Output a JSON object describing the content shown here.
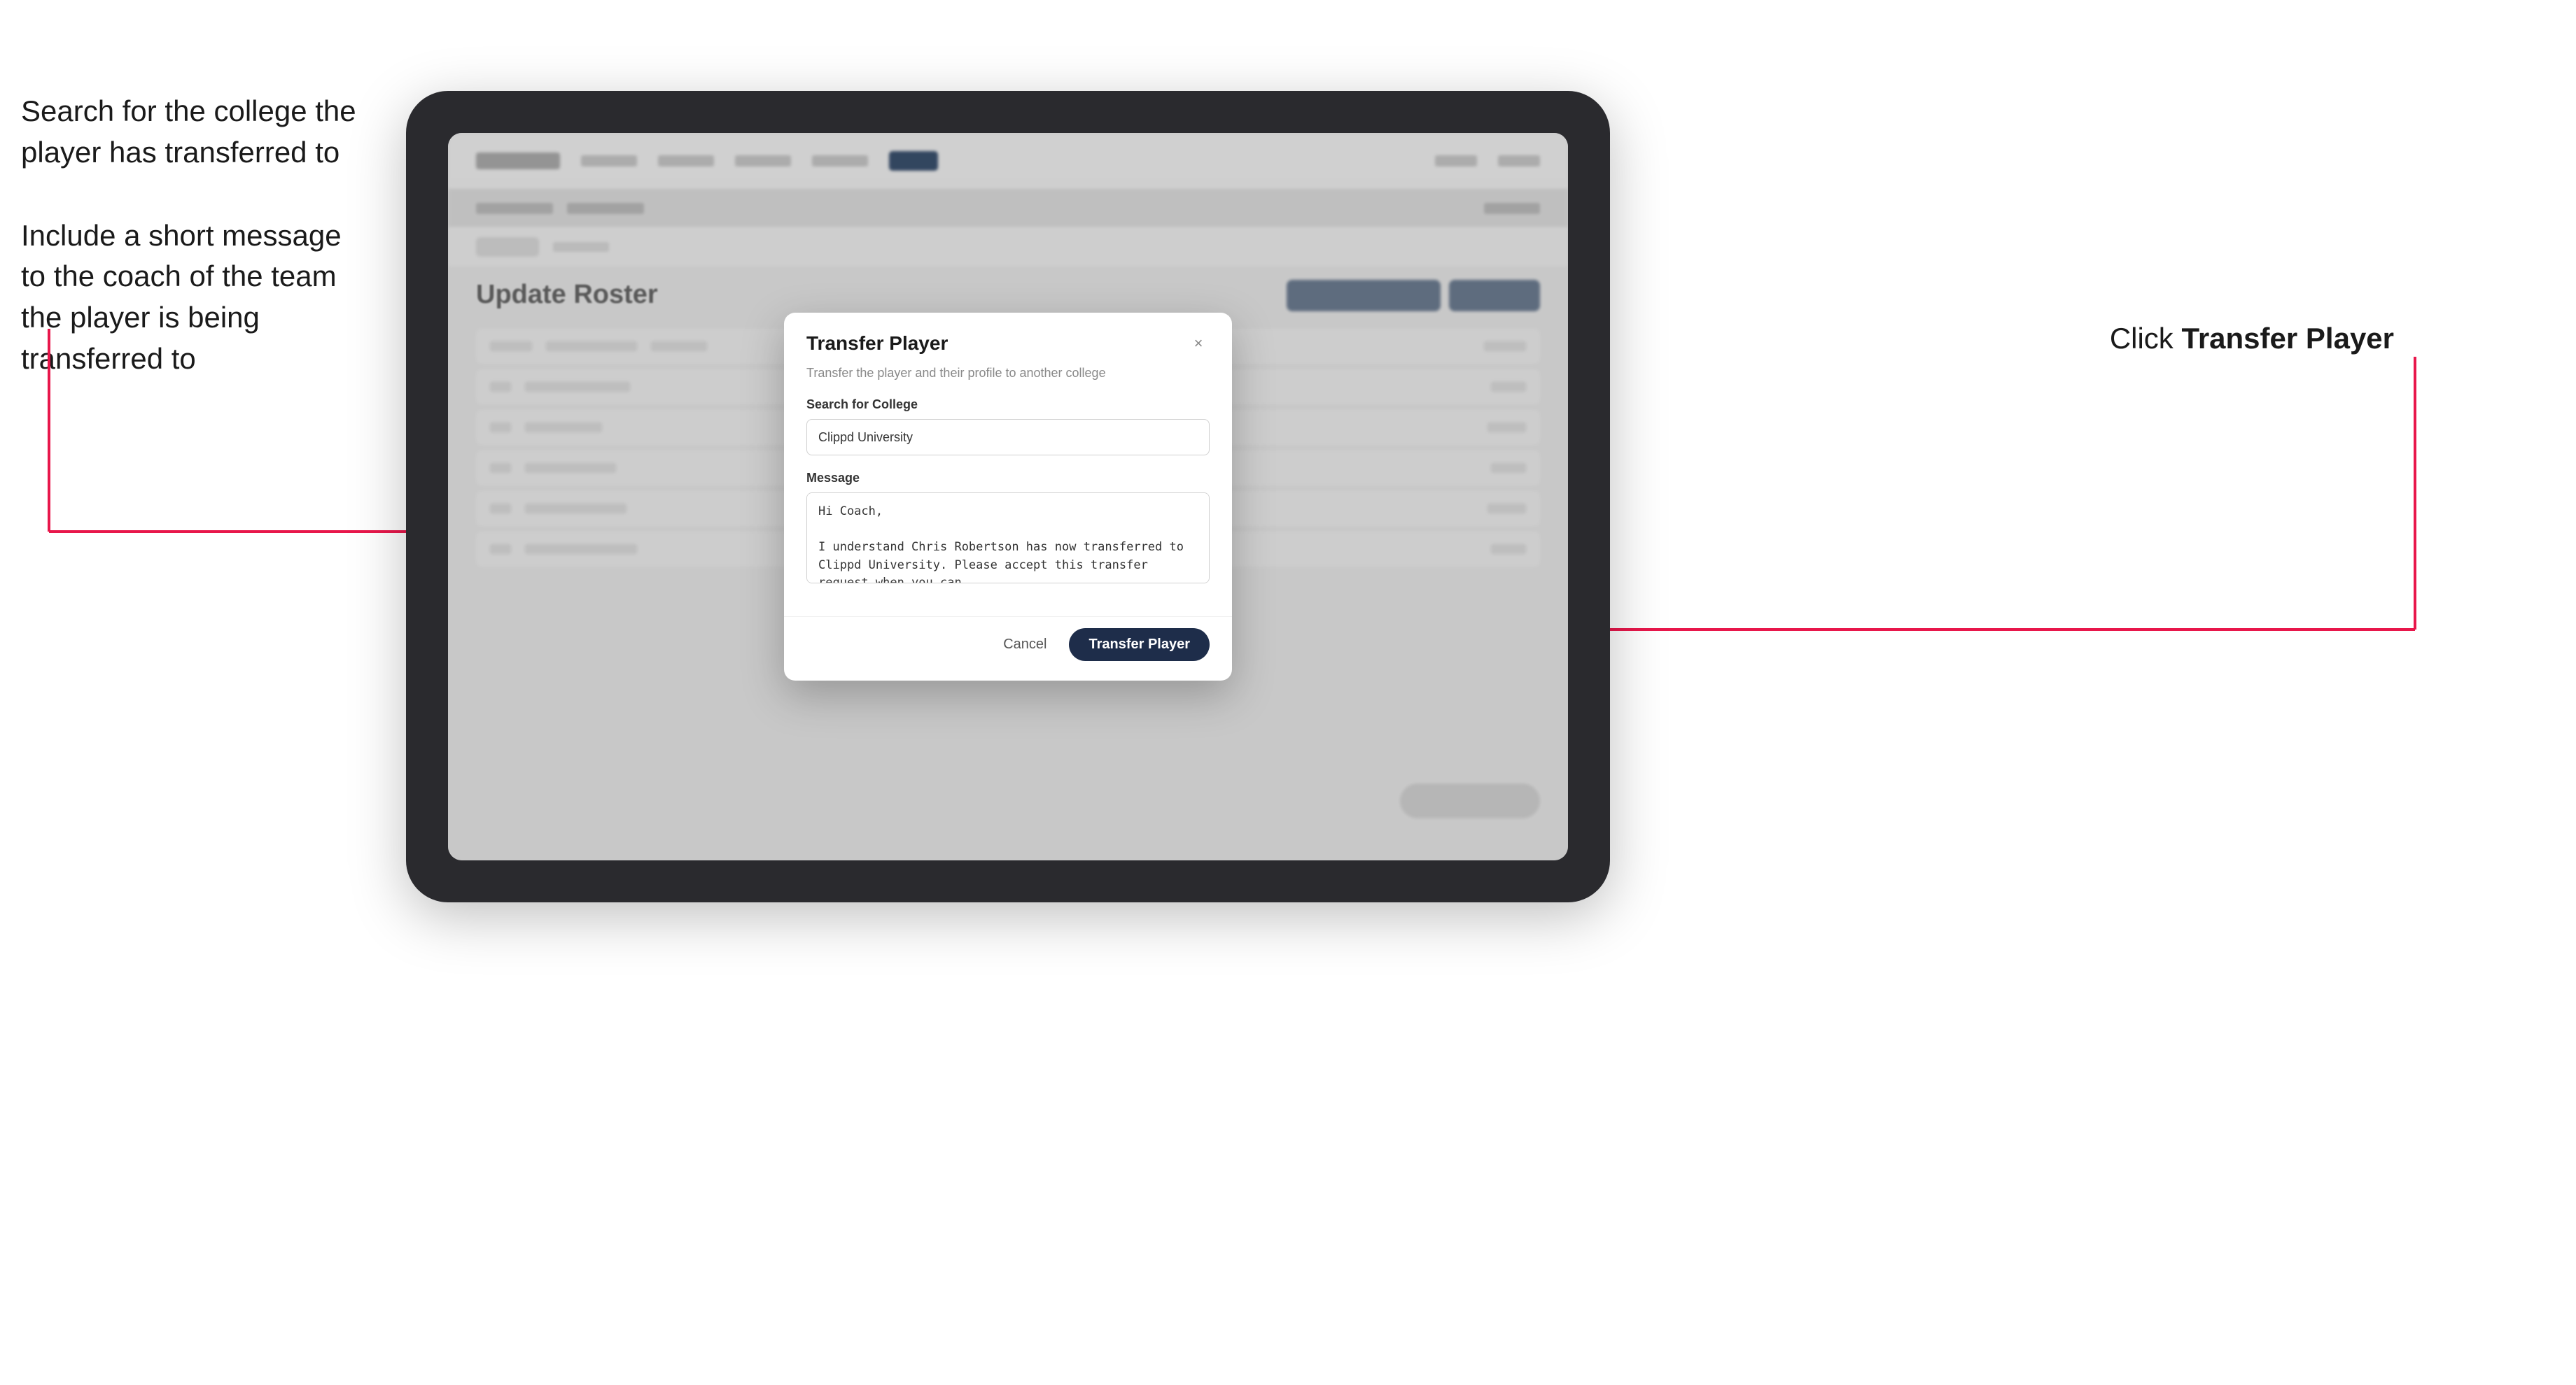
{
  "annotations": {
    "left_text_1": "Search for the college the player has transferred to",
    "left_text_2": "Include a short message to the coach of the team the player is being transferred to",
    "right_text_prefix": "Click ",
    "right_text_bold": "Transfer Player"
  },
  "tablet": {
    "app": {
      "page_title": "Update Roster"
    }
  },
  "modal": {
    "title": "Transfer Player",
    "subtitle": "Transfer the player and their profile to another college",
    "close_label": "×",
    "search_label": "Search for College",
    "search_value": "Clippd University",
    "search_placeholder": "Search for College",
    "message_label": "Message",
    "message_value": "Hi Coach,\n\nI understand Chris Robertson has now transferred to Clippd University. Please accept this transfer request when you can.",
    "cancel_label": "Cancel",
    "transfer_label": "Transfer Player"
  }
}
